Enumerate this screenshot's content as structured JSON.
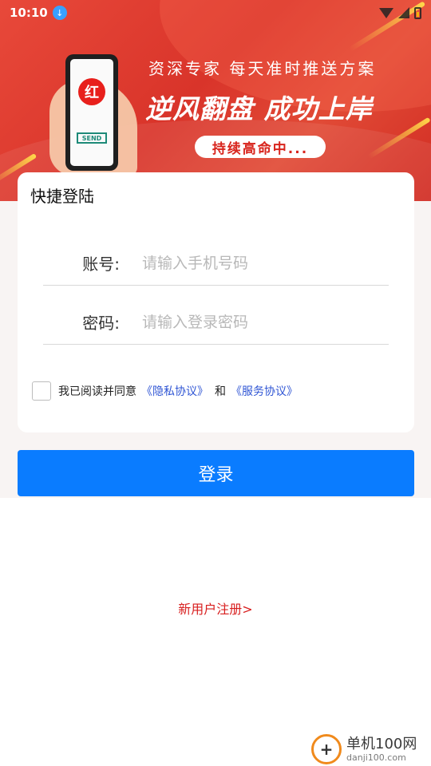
{
  "status_bar": {
    "time": "10:10"
  },
  "banner": {
    "phone_logo": "红",
    "phone_send": "SEND",
    "line1": "资深专家 每天准时推送方案",
    "line2": "逆风翻盘 成功上岸",
    "pill": "持续高命中..."
  },
  "login": {
    "title": "快捷登陆",
    "account_label": "账号:",
    "account_placeholder": "请输入手机号码",
    "password_label": "密码:",
    "password_placeholder": "请输入登录密码",
    "agree_text": "我已阅读并同意",
    "privacy_link": "《隐私协议》",
    "and_text": "和",
    "service_link": "《服务协议》",
    "submit_label": "登录"
  },
  "register_link": "新用户注册>",
  "watermark": {
    "main": "单机100网",
    "sub": "danji100.com"
  },
  "colors": {
    "banner_red": "#d9342a",
    "primary_blue": "#0a7cff",
    "link_blue": "#2f55d4",
    "register_red": "#d81e1e"
  },
  "icons": [
    "download-icon",
    "wifi-icon",
    "signal-icon",
    "battery-icon"
  ]
}
